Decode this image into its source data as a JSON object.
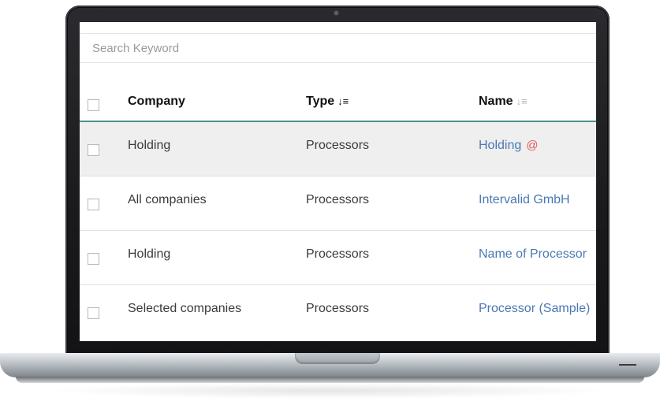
{
  "search": {
    "placeholder": "Search Keyword"
  },
  "table": {
    "columns": [
      {
        "label": "Company",
        "sort": "none"
      },
      {
        "label": "Type",
        "sort": "active",
        "sort_icon": "↓≡"
      },
      {
        "label": "Name",
        "sort": "inactive",
        "sort_icon": "↓≡"
      }
    ],
    "rows": [
      {
        "company": "Holding",
        "type": "Processors",
        "name": "Holding",
        "flag_icon": "@",
        "highlighted": true
      },
      {
        "company": "All companies",
        "type": "Processors",
        "name": "Intervalid GmbH",
        "highlighted": false
      },
      {
        "company": "Holding",
        "type": "Processors",
        "name": "Name of Processor",
        "highlighted": false
      },
      {
        "company": "Selected companies",
        "type": "Processors",
        "name": "Processor (Sample)",
        "highlighted": false
      }
    ]
  },
  "colors": {
    "link": "#4a78b5",
    "accent_border": "#4f8f8a",
    "flag_icon": "#e2565c",
    "row_highlight": "#efefef"
  }
}
